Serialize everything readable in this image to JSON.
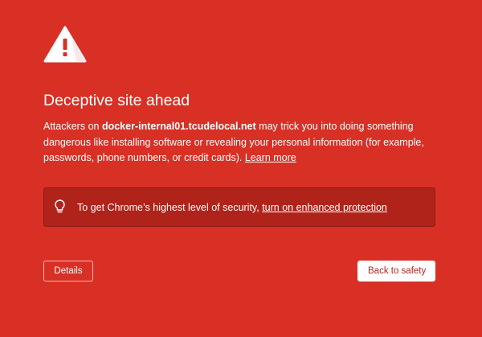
{
  "page": {
    "icon": "warning-triangle-icon",
    "title": "Deceptive site ahead",
    "explanation": {
      "prefix": "Attackers on ",
      "domain": "docker-internal01.tcudelocal.net",
      "suffix": " may trick you into doing something dangerous like installing software or revealing your personal information (for example, passwords, phone numbers, or credit cards). ",
      "learn_more": "Learn more"
    },
    "enhanced_protection": {
      "icon": "lightbulb-icon",
      "text": "To get Chrome’s highest level of security, ",
      "link": "turn on enhanced protection"
    },
    "buttons": {
      "details": "Details",
      "back_to_safety": "Back to safety"
    }
  },
  "colors": {
    "background": "#d93025",
    "box": "#b0231b",
    "button_text": "#b3261e"
  }
}
